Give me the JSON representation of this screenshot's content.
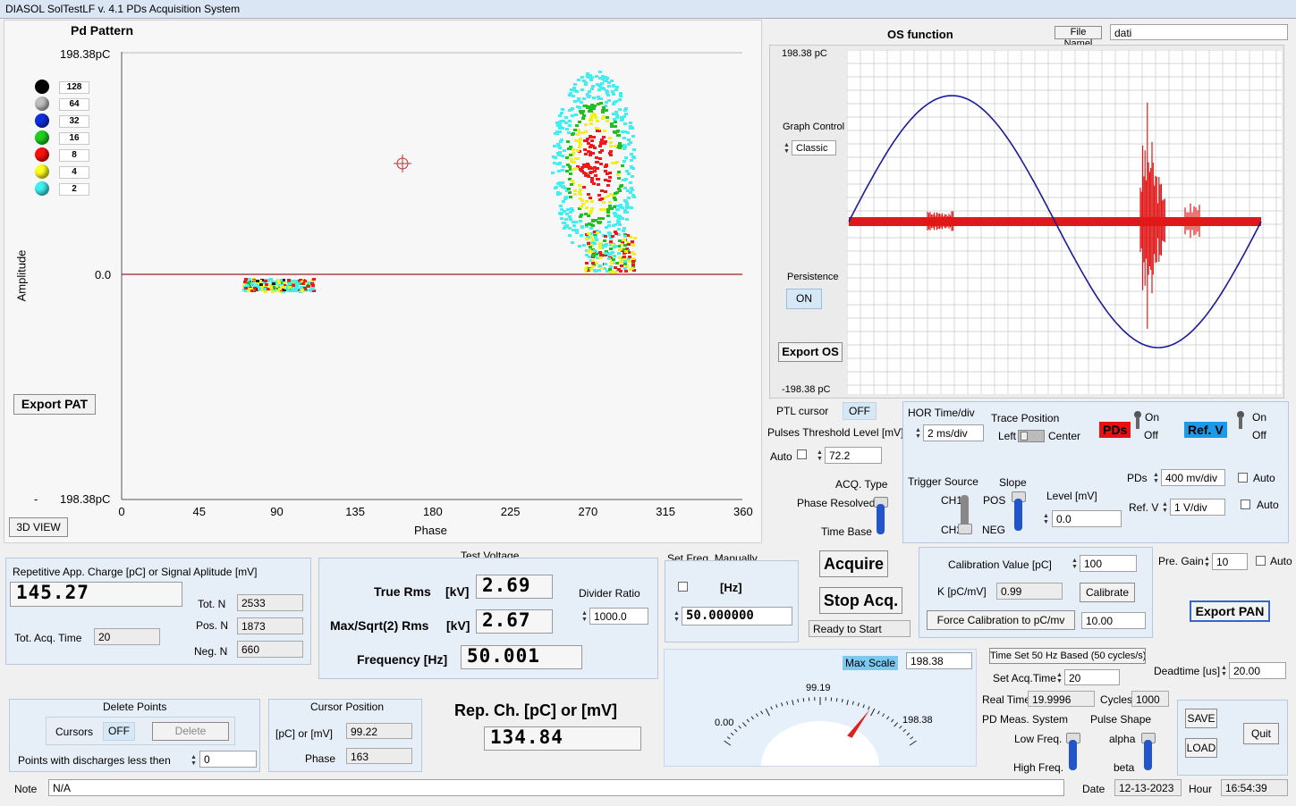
{
  "window_title": "DIASOL SolTestLF v. 4.1 PDs Acquisition System",
  "pattern": {
    "title": "Pd Pattern",
    "y_top": "198.38pC",
    "y_zero": "0.0",
    "y_bottom": "198.38pC",
    "y_bottom_dash": "-",
    "ylabel": "Amplitude",
    "xlabel": "Phase",
    "x_ticks": [
      "0",
      "45",
      "90",
      "135",
      "180",
      "225",
      "270",
      "315",
      "360"
    ],
    "legend": [
      {
        "color": "#000000",
        "label": "128"
      },
      {
        "color": "#c0c0c0",
        "label": "64"
      },
      {
        "color": "#1030e0",
        "label": "32"
      },
      {
        "color": "#20d020",
        "label": "16"
      },
      {
        "color": "#ff1010",
        "label": "8"
      },
      {
        "color": "#ffff20",
        "label": "4"
      },
      {
        "color": "#40f0f0",
        "label": "2"
      }
    ],
    "export_btn": "Export PAT",
    "view3d_btn": "3D VIEW"
  },
  "os": {
    "title": "OS function",
    "file_name_label": "File Namel",
    "file_name_value": "dati",
    "y_top": "198.38 pC",
    "y_bottom": "-198.38 pC",
    "graph_control_label": "Graph Control",
    "graph_control_value": "Classic",
    "persistence_label": "Persistence",
    "persistence_value": "ON",
    "export_btn": "Export OS"
  },
  "ctrl": {
    "ptl_label": "PTL cursor",
    "ptl_value": "OFF",
    "threshold_label": "Pulses Threshold Level  [mV]",
    "auto_label": "Auto",
    "threshold_value": "72.2",
    "acq_type_label": "ACQ. Type",
    "phase_resolved": "Phase Resolved",
    "time_base": "Time Base",
    "hor_label": "HOR Time/div",
    "hor_value": "2 ms/div",
    "trace_pos_label": "Trace Position",
    "left": "Left",
    "center": "Center",
    "pds_badge": "PDs",
    "refv_badge": "Ref. V",
    "on": "On",
    "off": "Off",
    "trigger_label": "Trigger Source",
    "ch1": "CH1",
    "ch2": "CH2",
    "slope_label": "Slope",
    "pos": "POS",
    "neg": "NEG",
    "level_label": "Level [mV]",
    "level_value": "0.0",
    "pds_scale_label": "PDs",
    "pds_scale_value": "400 mv/div",
    "refv_scale_label": "Ref. V",
    "refv_scale_value": "1 V/div",
    "auto": "Auto"
  },
  "rep": {
    "title": "Repetitive App. Charge [pC] or Signal Aplitude [mV]",
    "value": "145.27",
    "tot_n_label": "Tot. N",
    "tot_n": "2533",
    "pos_n_label": "Pos. N",
    "pos_n": "1873",
    "neg_n_label": "Neg. N",
    "neg_n": "660",
    "acq_time_label": "Tot. Acq. Time",
    "acq_time": "20"
  },
  "tv": {
    "title": "Test Voltage",
    "true_rms_label": "True Rms",
    "kv": "[kV]",
    "true_rms": "2.69",
    "max_label": "Max/Sqrt(2) Rms",
    "max_rms": "2.67",
    "freq_label": "Frequency [Hz]",
    "freq": "50.001",
    "divider_label": "Divider Ratio",
    "divider": "1000.0"
  },
  "freq": {
    "title": "Set Freq. Manually",
    "hz": "[Hz]",
    "value": "50.000000"
  },
  "acq": {
    "acquire": "Acquire",
    "stop": "Stop Acq.",
    "status": "Ready to Start"
  },
  "cal": {
    "value_label": "Calibration Value [pC]",
    "value": "100",
    "k_label": "K [pC/mV]",
    "k_value": "0.99",
    "calibrate_btn": "Calibrate",
    "force_btn": "Force Calibration to pC/mv",
    "force_value": "10.00",
    "pregain_label": "Pre. Gain",
    "pregain": "10",
    "auto": "Auto",
    "export_pan": "Export PAN"
  },
  "gauge": {
    "max_scale_label": "Max Scale",
    "max_scale": "198.38",
    "min": "0.00",
    "mid": "99.19",
    "max": "198.38",
    "value_fraction": 0.7323
  },
  "time": {
    "timeset_btn": "Time Set 50 Hz Based (50 cycles/s)",
    "set_acq_label": "Set Acq.Time",
    "set_acq": "20",
    "deadtime_label": "Deadtime [us]",
    "deadtime": "20.00",
    "real_time_label": "Real Time",
    "real_time": "19.9996",
    "cycles_label": "Cycles",
    "cycles": "1000",
    "meas_label": "PD Meas. System",
    "low_freq": "Low Freq.",
    "high_freq": "High Freq.",
    "shape_label": "Pulse Shape",
    "alpha": "alpha",
    "beta": "beta",
    "save": "SAVE",
    "load": "LOAD",
    "quit": "Quit"
  },
  "del": {
    "title": "Delete Points",
    "cursors_label": "Cursors",
    "cursors_value": "OFF",
    "delete_btn": "Delete",
    "points_label": "Points with discharges less then",
    "points_value": "0"
  },
  "cursor": {
    "title": "Cursor Position",
    "pc_label": "[pC] or [mV]",
    "pc_value": "99.22",
    "phase_label": "Phase",
    "phase_value": "163"
  },
  "repch": {
    "label": "Rep. Ch. [pC] or  [mV]",
    "value": "134.84"
  },
  "footer": {
    "note_label": "Note",
    "note_value": "N/A",
    "date_label": "Date",
    "date_value": "12-13-2023",
    "hour_label": "Hour",
    "hour_value": "16:54:39"
  }
}
